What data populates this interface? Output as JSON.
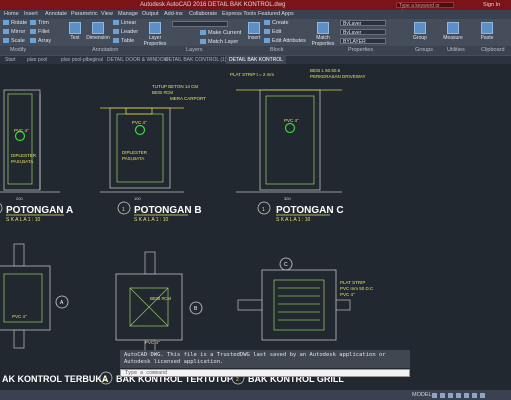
{
  "titlebar": {
    "title": "Autodesk AutoCAD 2016   DETAIL BAK KONTROL.dwg",
    "search_placeholder": "Type a keyword or phrase",
    "signin": "Sign In"
  },
  "menu": [
    "Home",
    "Insert",
    "Annotate",
    "Parametric",
    "View",
    "Manage",
    "Output",
    "Add-ins",
    "Collaborate",
    "Express Tools",
    "Featured Apps"
  ],
  "ribbon": {
    "modify_tools": [
      "Rotate",
      "Mirror",
      "Scale",
      "Trim",
      "Fillet",
      "Array"
    ],
    "text_label": "Text",
    "dimension_label": "Dimension",
    "annotation_tools": [
      "Linear",
      "Leader",
      "Table"
    ],
    "layer_properties_label": "Layer Properties",
    "layer_tools": [
      "Make Current",
      "Match Layer"
    ],
    "insert_label": "Insert",
    "block_tools": [
      "Create",
      "Edit",
      "Edit Attributes"
    ],
    "match_properties_label": "Match Properties",
    "prop_values": [
      "ByLayer",
      "ByLayer",
      "BYLAYER"
    ],
    "groups_label": "Group",
    "measure_label": "Measure",
    "paste_label": "Paste",
    "panels": [
      "Modify",
      "Annotation",
      "Layers",
      "Block",
      "Properties",
      "Groups",
      "Utilities",
      "Clipboard"
    ]
  },
  "file_tabs": [
    "Start",
    "plan pool",
    "plan pool-plbeginal",
    "DETAIL DOOR & WINDOW",
    "DETAIL BAK CONTROL (1)",
    "DETAIL BAK KONTROL"
  ],
  "drawing": {
    "section_titles": [
      "POTONGAN A",
      "POTONGAN B",
      "POTONGAN C"
    ],
    "plan_titles": [
      "AK KONTROL TERBUKA",
      "BAK KONTROL TERTUTUP",
      "BAK KONTROL GRILL"
    ],
    "scale_text": "S K A L A  1 : 10",
    "bubble_numbers": [
      "1",
      "1",
      "1",
      "2",
      "2",
      "2"
    ],
    "pvc_label": "PVC 4\"",
    "section_labels_b": [
      "TUTUP BETON 14 CM",
      "BESI #CM",
      "MERA CARPORT",
      "DIPLESTER",
      "PASI,BATA"
    ],
    "section_labels_c": [
      "BESI L 50.50.5",
      "PERKERASAN DRIVEWAY",
      "PLAT STRIP t = 2 mm"
    ],
    "section_labels_a": [
      "DIPLESTER",
      "PASI,BATA"
    ],
    "plan_labels_grill": [
      "PLAT STRIP",
      "PVC mm 50 D.C",
      "PVC 4\""
    ],
    "plan_label_besi": "BESI #CM",
    "section_markers": [
      "A",
      "B",
      "C"
    ],
    "dims": [
      "200",
      "100",
      "300",
      "500",
      "500",
      "500"
    ]
  },
  "command": {
    "history": "AutoCAD DWG.  This file is a TrustedDWG last saved by an Autodesk application or Autodesk licensed application.",
    "prompt": "Type a command"
  },
  "status": {
    "model": "MODEL"
  }
}
